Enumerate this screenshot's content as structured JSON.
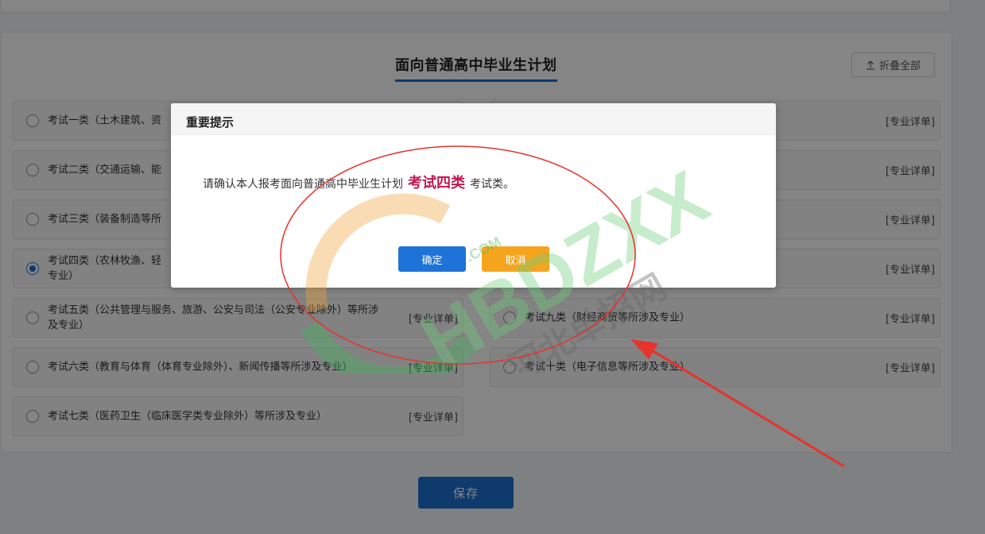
{
  "section": {
    "title": "面向普通高中毕业生计划",
    "collapse_label": "折叠全部"
  },
  "options": [
    {
      "label": "考试一类（土木建筑、资",
      "detail": "[专业详单]",
      "checked": false
    },
    {
      "label": "考试二类（交通运输、能",
      "detail": "[专业详单]",
      "checked": false
    },
    {
      "label": "考试三类（装备制造等所",
      "detail": "[专业详单]",
      "checked": false
    },
    {
      "label": "考试四类（农林牧渔、轻",
      "label2": "专业）",
      "detail": "[专业详单]",
      "checked": true
    },
    {
      "label": "考试五类（公共管理与服务、旅游、公安与司法（公安专业除外）等所涉",
      "label2": "及专业）",
      "detail": "[专业详单]",
      "checked": false
    },
    {
      "label": "考试六类（教育与体育（体育专业除外）、新闻传播等所涉及专业）",
      "detail": "[专业详单]",
      "checked": false
    },
    {
      "label": "考试七类（医药卫生（临床医学类专业除外）等所涉及专业）",
      "detail": "[专业详单]",
      "checked": false
    }
  ],
  "right_options": [
    {
      "label": "",
      "detail": "[专业详单]"
    },
    {
      "label": "",
      "detail": "[专业详单]"
    },
    {
      "label": "",
      "detail": "[专业详单]"
    },
    {
      "label": "",
      "detail": "[专业详单]"
    },
    {
      "label": "考试九类（财经商贸等所涉及专业）",
      "detail": "[专业详单]"
    },
    {
      "label": "考试十类（电子信息等所涉及专业）",
      "detail": "[专业详单]"
    }
  ],
  "save_label": "保存",
  "modal": {
    "title": "重要提示",
    "message_prefix": "请确认本人报考面向普通高中毕业生计划",
    "highlight": "考试四类",
    "message_suffix": "考试类。",
    "confirm_label": "确定",
    "cancel_label": "取消"
  },
  "watermark": {
    "brand": "HBDZXX",
    "domain": ".COM",
    "cn_text": "河北单招网"
  },
  "colors": {
    "primary": "#1e73d8",
    "warning": "#f5a51d",
    "highlight": "#c2174f",
    "annotation": "#e8322c"
  }
}
